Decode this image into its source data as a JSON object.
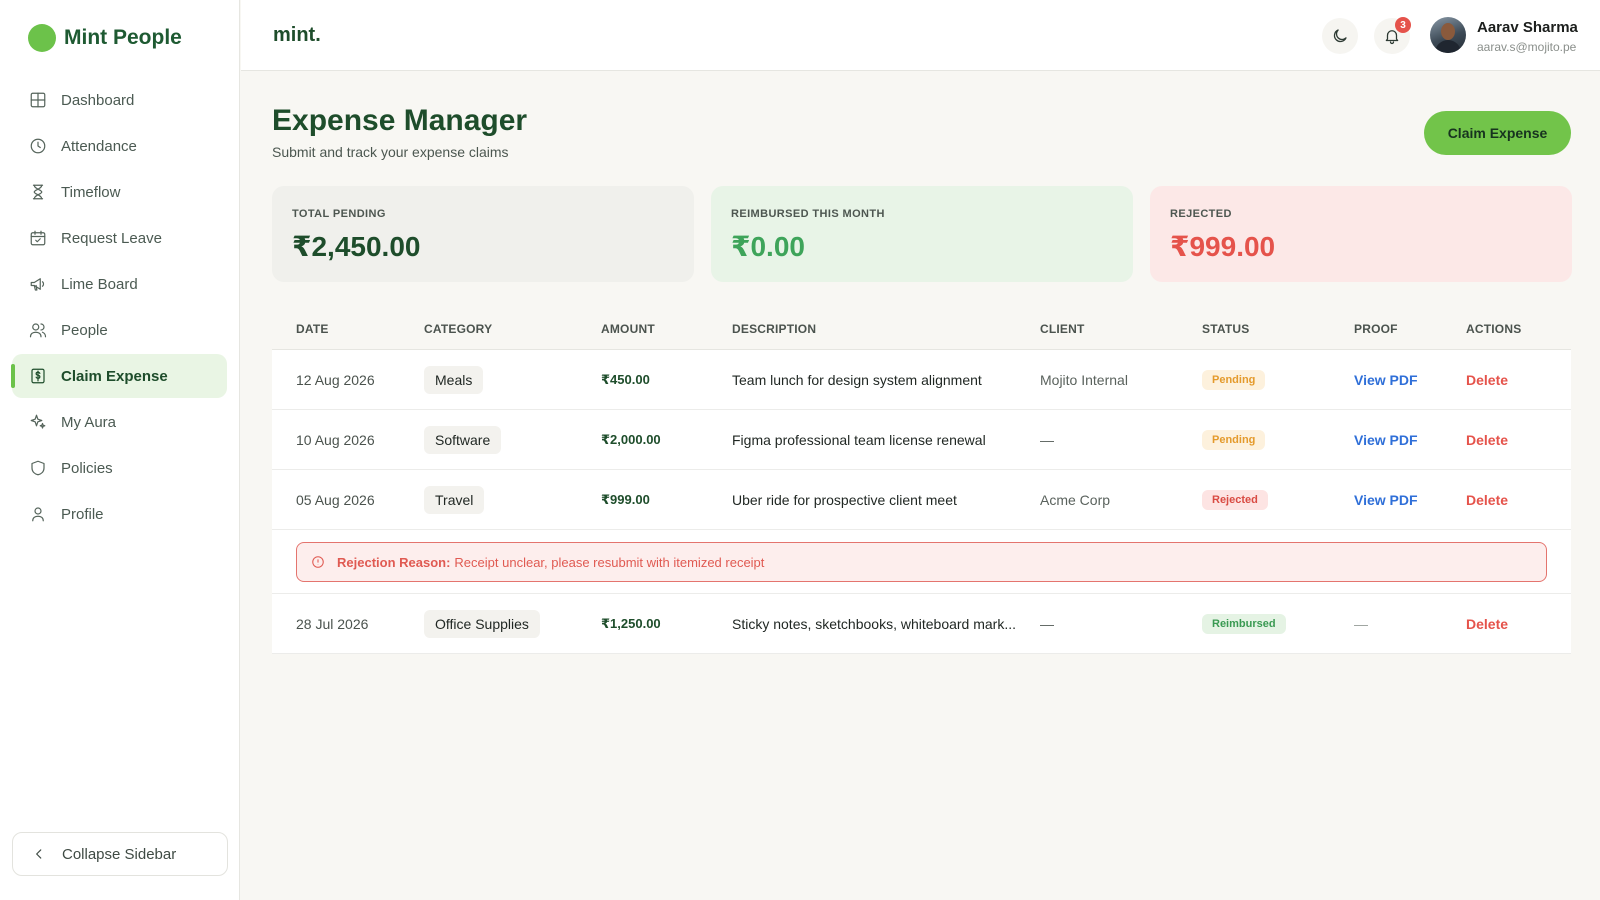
{
  "sidebar": {
    "brand": "Mint People",
    "items": [
      {
        "label": "Dashboard",
        "icon": "grid-icon"
      },
      {
        "label": "Attendance",
        "icon": "clock-icon"
      },
      {
        "label": "Timeflow",
        "icon": "hourglass-icon"
      },
      {
        "label": "Request Leave",
        "icon": "calendar-check-icon"
      },
      {
        "label": "Lime Board",
        "icon": "megaphone-icon"
      },
      {
        "label": "People",
        "icon": "users-icon"
      },
      {
        "label": "Claim Expense",
        "icon": "receipt-icon",
        "active": true
      },
      {
        "label": "My Aura",
        "icon": "sparkle-icon"
      },
      {
        "label": "Policies",
        "icon": "shield-icon"
      },
      {
        "label": "Profile",
        "icon": "user-icon"
      }
    ],
    "collapse_label": "Collapse Sidebar"
  },
  "topbar": {
    "logo": "mint.",
    "notification_count": "3",
    "user": {
      "name": "Aarav Sharma",
      "email": "aarav.s@mojito.pe"
    }
  },
  "page": {
    "title": "Expense Manager",
    "subtitle": "Submit and track your expense claims",
    "claim_button": "Claim Expense"
  },
  "summary": {
    "pending": {
      "label": "TOTAL PENDING",
      "value": "₹2,450.00"
    },
    "reimbursed": {
      "label": "REIMBURSED THIS MONTH",
      "value": "₹0.00"
    },
    "rejected": {
      "label": "REJECTED",
      "value": "₹999.00"
    }
  },
  "table": {
    "headers": [
      "DATE",
      "CATEGORY",
      "AMOUNT",
      "DESCRIPTION",
      "CLIENT",
      "STATUS",
      "PROOF",
      "ACTIONS"
    ],
    "rows": [
      {
        "date": "12 Aug 2026",
        "category": "Meals",
        "amount": "₹450.00",
        "description": "Team lunch for design system alignment",
        "client": "Mojito Internal",
        "status": "Pending",
        "proof": "View PDF",
        "action": "Delete"
      },
      {
        "date": "10 Aug 2026",
        "category": "Software",
        "amount": "₹2,000.00",
        "description": "Figma professional team license renewal",
        "client": "—",
        "status": "Pending",
        "proof": "View PDF",
        "action": "Delete"
      },
      {
        "date": "05 Aug 2026",
        "category": "Travel",
        "amount": "₹999.00",
        "description": "Uber ride for prospective client meet",
        "client": "Acme Corp",
        "status": "Rejected",
        "proof": "View PDF",
        "action": "Delete"
      },
      {
        "date": "28 Jul 2026",
        "category": "Office Supplies",
        "amount": "₹1,250.00",
        "description": "Sticky notes, sketchbooks, whiteboard mark...",
        "client": "—",
        "status": "Reimbursed",
        "proof": "—",
        "action": "Delete"
      }
    ],
    "rejection": {
      "label": "Rejection Reason:",
      "text": "Receipt unclear, please resubmit with itemized receipt"
    }
  },
  "colors": {
    "brand_green": "#6cc24a",
    "dark_green": "#1e4d2b",
    "danger": "#e5534b",
    "link": "#2f6fd8"
  }
}
